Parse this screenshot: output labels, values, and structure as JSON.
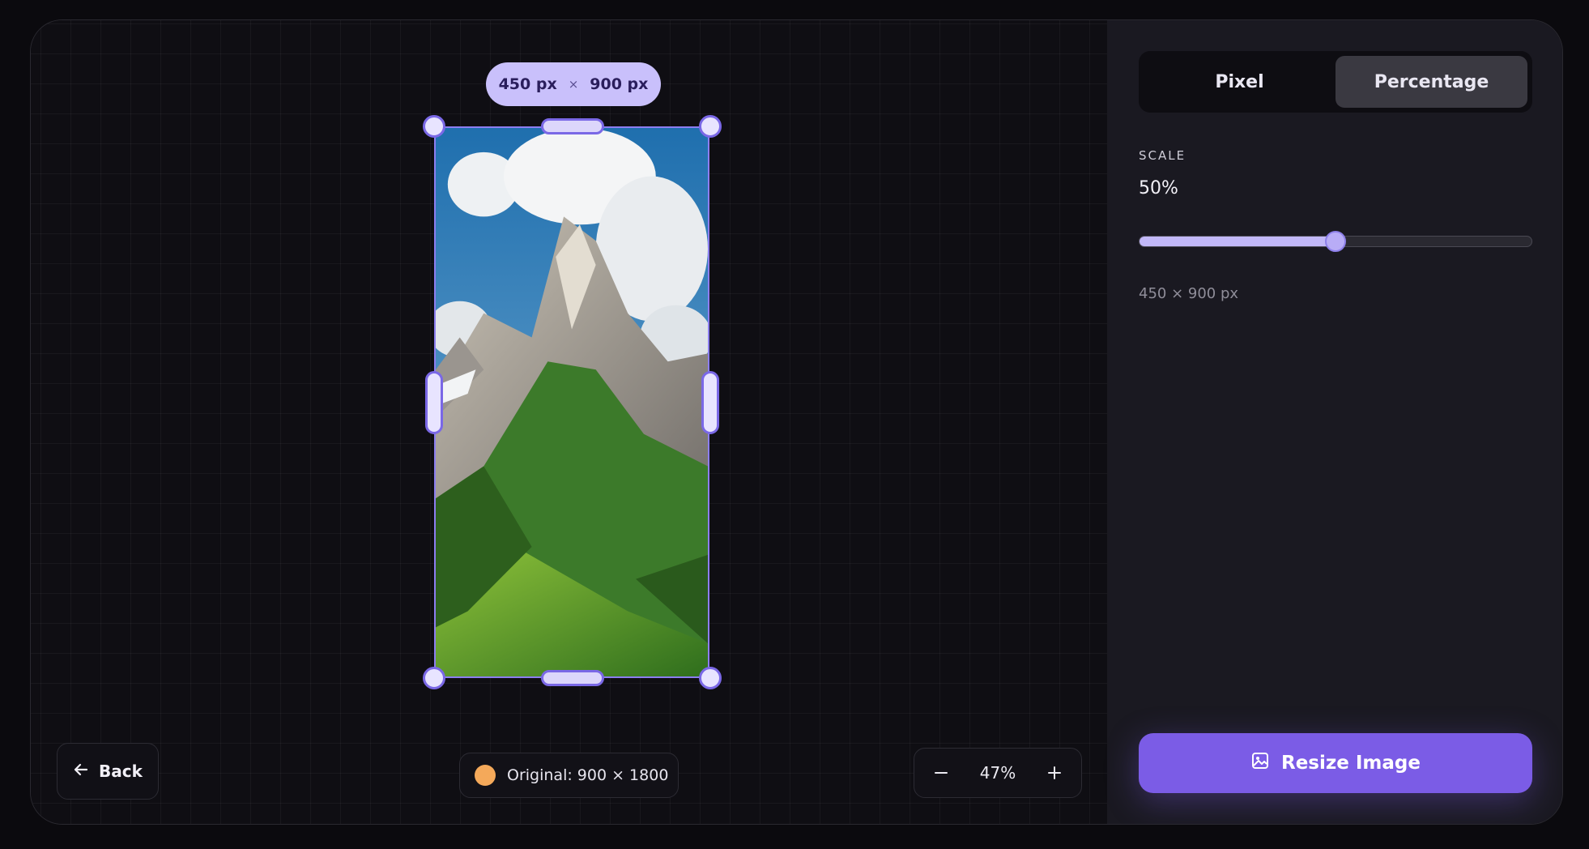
{
  "canvas": {
    "size_pill": {
      "width": "450 px",
      "separator": "×",
      "height": "900 px"
    },
    "image": {
      "alt": "mountain-landscape"
    },
    "back_label": "Back",
    "original_info": "Original: 900 × 1800",
    "zoom": {
      "value": "47%",
      "minus_icon": "minus-icon",
      "plus_icon": "plus-icon"
    }
  },
  "panel": {
    "toggle": {
      "options": [
        "Pixel",
        "Percentage"
      ],
      "active": "Percentage"
    },
    "scale_label": "SCALE",
    "scale_value": "50%",
    "slider_value": 0.5,
    "dimensions_readout": "450 × 900 px",
    "resize_button_label": "Resize Image"
  },
  "colors": {
    "accent": "#7b5ce6",
    "pill": "#c9c0fb",
    "handle_border": "#7a68e6",
    "original_dot": "#f4a95a"
  }
}
